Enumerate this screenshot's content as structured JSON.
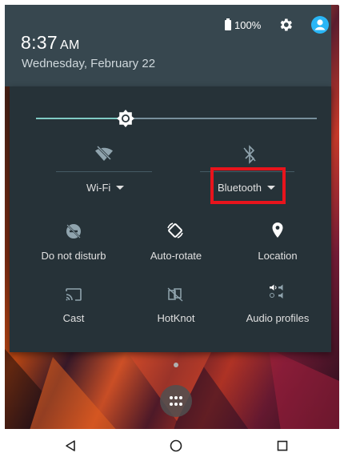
{
  "status": {
    "time": "8:37",
    "ampm": "AM",
    "date": "Wednesday, February 22",
    "battery": "100%"
  },
  "brightness": {
    "level": 0.32
  },
  "big_tiles": [
    {
      "label": "Wi-Fi",
      "icon": "wifi-off-icon"
    },
    {
      "label": "Bluetooth",
      "icon": "bluetooth-off-icon"
    }
  ],
  "tiles": [
    {
      "label": "Do not disturb",
      "icon": "do-not-disturb-icon"
    },
    {
      "label": "Auto-rotate",
      "icon": "auto-rotate-icon"
    },
    {
      "label": "Location",
      "icon": "location-icon"
    },
    {
      "label": "Cast",
      "icon": "cast-icon"
    },
    {
      "label": "HotKnot",
      "icon": "hotknot-icon"
    },
    {
      "label": "Audio profiles",
      "icon": "audio-profiles-icon"
    }
  ],
  "colors": {
    "header": "#37474f",
    "panel": "#263238",
    "accent": "#80cbc4",
    "highlight": "#e8141c"
  },
  "navigation": [
    "back-icon",
    "home-icon",
    "recents-icon"
  ]
}
